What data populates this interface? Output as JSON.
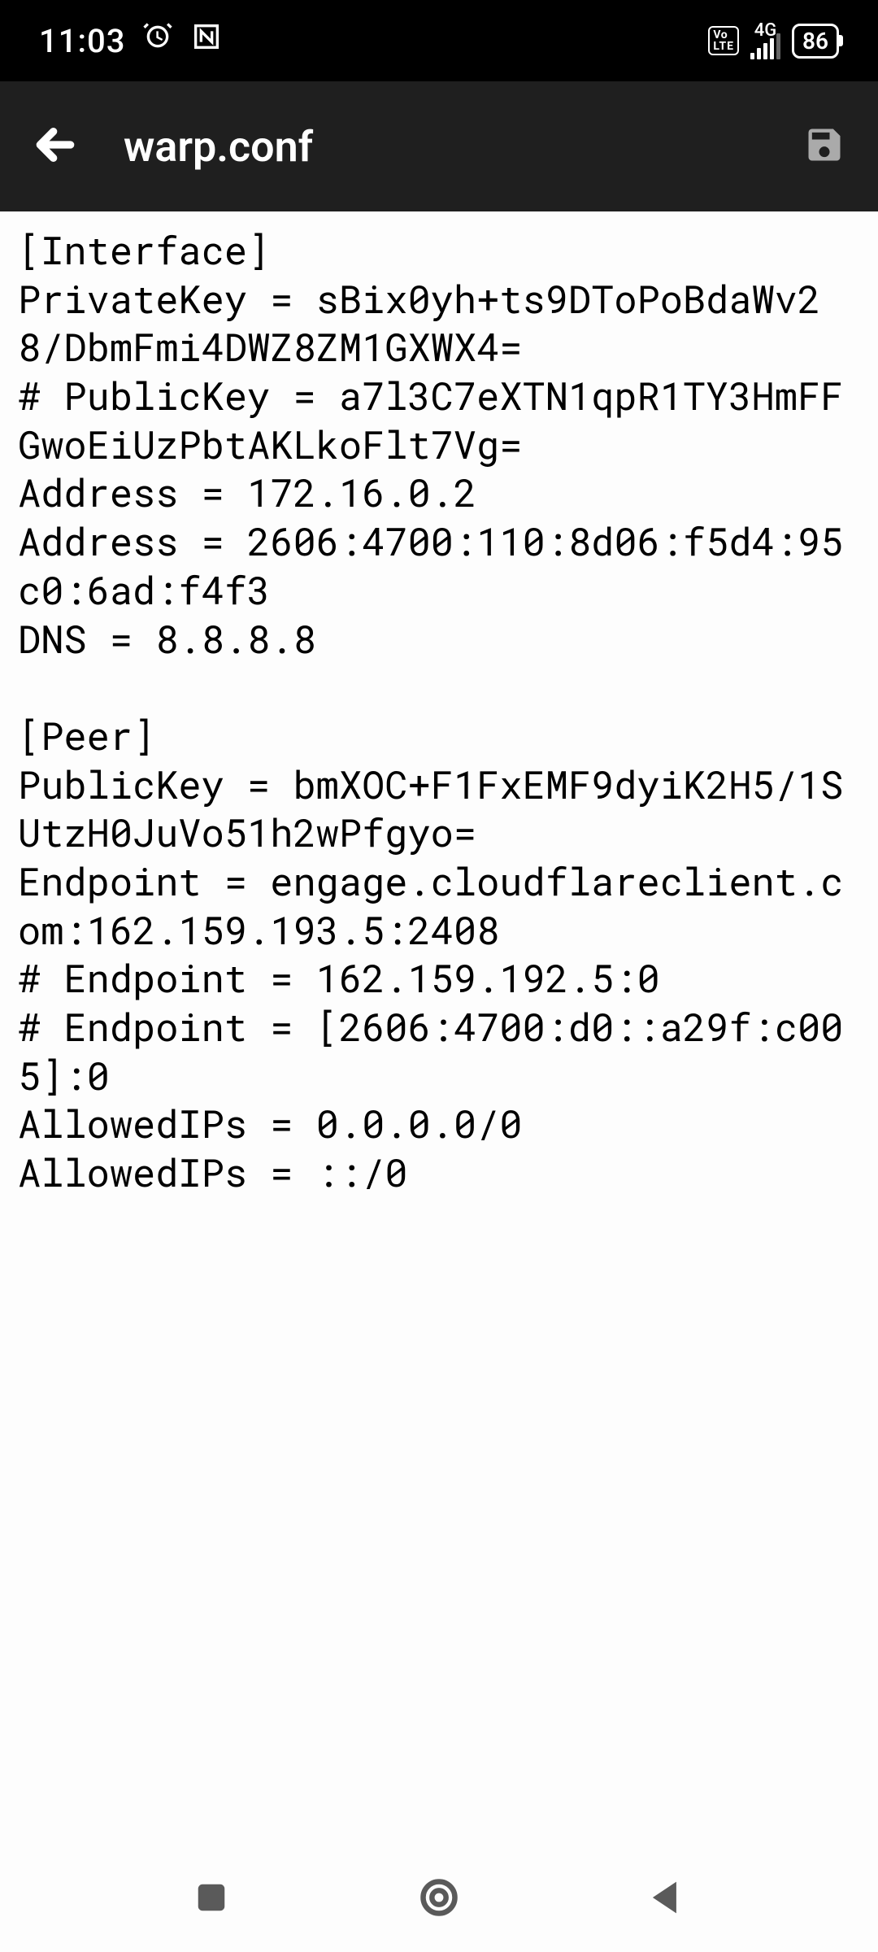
{
  "status": {
    "time": "11:03",
    "network_label": "4G",
    "volte_top": "Vo",
    "volte_bot": "LTE",
    "battery": "86"
  },
  "appbar": {
    "title": "warp.conf"
  },
  "file": {
    "content": "[Interface]\nPrivateKey = sBix0yh+ts9DToPoBdaWv28/DbmFmi4DWZ8ZM1GXWX4=\n# PublicKey = a7l3C7eXTN1qpR1TY3HmFFGwoEiUzPbtAKLkoFlt7Vg=\nAddress = 172.16.0.2\nAddress = 2606:4700:110:8d06:f5d4:95c0:6ad:f4f3\nDNS = 8.8.8.8\n\n[Peer]\nPublicKey = bmXOC+F1FxEMF9dyiK2H5/1SUtzH0JuVo51h2wPfgyo=\nEndpoint = engage.cloudflareclient.com:162.159.193.5:2408\n# Endpoint = 162.159.192.5:0\n# Endpoint = [2606:4700:d0::a29f:c005]:0\nAllowedIPs = 0.0.0.0/0\nAllowedIPs = ::/0"
  }
}
